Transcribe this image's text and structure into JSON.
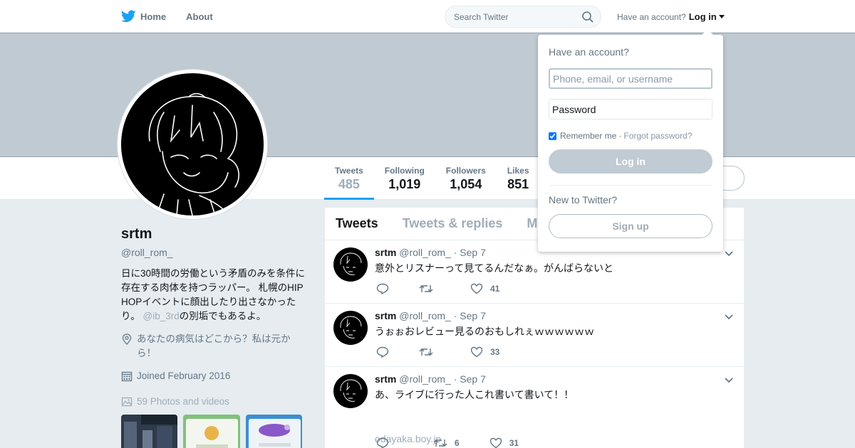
{
  "nav": {
    "home_label": "Home",
    "about_label": "About",
    "search_placeholder": "Search Twitter",
    "have_account": "Have an account?",
    "login_label": "Log in"
  },
  "profile_stats": [
    {
      "label": "Tweets",
      "value": "485"
    },
    {
      "label": "Following",
      "value": "1,019"
    },
    {
      "label": "Followers",
      "value": "1,054"
    },
    {
      "label": "Likes",
      "value": "851"
    }
  ],
  "profile": {
    "name": "srtm",
    "handle": "@roll_rom_",
    "bio_text": "日に30時間の労働という矛盾のみを条件に存在する肉体を持つラッパー。 札幌のHIP HOPイベントに顔出したり出さなかったり。",
    "bio_mention": "@ib_3rd",
    "bio_suffix": "の別垢でもあるよ。",
    "location": "あなたの病気はどこから？私は元から！",
    "joined": "Joined February 2016",
    "photos": "59 Photos and videos"
  },
  "timeline": {
    "tabs": [
      "Tweets",
      "Tweets & replies",
      "Media"
    ],
    "tweets": [
      {
        "name": "srtm",
        "handle": "@roll_rom_",
        "date": "· Sep 7",
        "text": "意外とリスナーって見てるんだなぁ。がんばらないと",
        "link": "",
        "retweets": "",
        "likes": "41"
      },
      {
        "name": "srtm",
        "handle": "@roll_rom_",
        "date": "· Sep 7",
        "text": "うぉぉおレビュー見るのおもしれぇｗｗｗｗｗｗ",
        "link": "",
        "retweets": "",
        "likes": "33"
      },
      {
        "name": "srtm",
        "handle": "@roll_rom_",
        "date": "· Sep 7",
        "text": "あ、ライブに行った人これ書いて書いて！！",
        "link": "odayaka.boy.jp",
        "retweets": "6",
        "likes": "31"
      }
    ]
  },
  "login_dropdown": {
    "title": "Have an account?",
    "username_placeholder": "Phone, email, or username",
    "password_placeholder": "Password",
    "remember_label": "Remember me",
    "separator": "·",
    "forgot_label": "Forgot password?",
    "login_button": "Log in",
    "new_label": "New to Twitter?",
    "signup_button": "Sign up"
  },
  "colors": {
    "brand": "#1da1f2",
    "banner": "#c0cad3",
    "muted": "#657786"
  }
}
